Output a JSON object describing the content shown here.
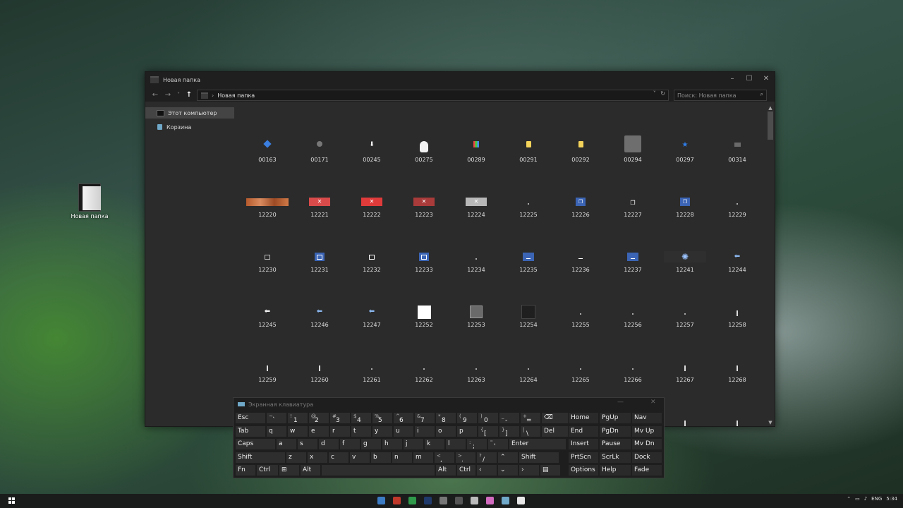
{
  "desktop": {
    "icon_label": "Новая папка"
  },
  "window": {
    "title": "Новая папка",
    "controls": {
      "minimize": "–",
      "maximize": "☐",
      "close": "✕"
    },
    "nav": {
      "back": "←",
      "forward": "→",
      "recent": "˅",
      "up": "↑"
    },
    "address": {
      "separator": "›",
      "path": "Новая папка",
      "dropdown": "˅",
      "refresh": "↻"
    },
    "search": {
      "placeholder": "Поиск: Новая папка",
      "icon": "⌕"
    },
    "sidebar": [
      {
        "label": "Этот компьютер",
        "icon": "computer-icon"
      },
      {
        "label": "Корзина",
        "icon": "recycle-bin-icon"
      }
    ],
    "items": [
      {
        "label": "00163",
        "thumb": "blue-pin"
      },
      {
        "label": "00171",
        "thumb": "gray-globe"
      },
      {
        "label": "00245",
        "thumb": "down-arrow"
      },
      {
        "label": "00275",
        "thumb": "white-head"
      },
      {
        "label": "00289",
        "thumb": "color-grid"
      },
      {
        "label": "00291",
        "thumb": "yellow-note"
      },
      {
        "label": "00292",
        "thumb": "yellow-note"
      },
      {
        "label": "00294",
        "thumb": "gray-square"
      },
      {
        "label": "00297",
        "thumb": "blue-star"
      },
      {
        "label": "00314",
        "thumb": "gray-folder"
      },
      {
        "label": "12220",
        "thumb": "rust-bar"
      },
      {
        "label": "12221",
        "thumb": "red-close"
      },
      {
        "label": "12222",
        "thumb": "red-close-bright"
      },
      {
        "label": "12223",
        "thumb": "red-close-dark"
      },
      {
        "label": "12224",
        "thumb": "gray-close"
      },
      {
        "label": "12225",
        "thumb": "tiny-dot"
      },
      {
        "label": "12226",
        "thumb": "blue-restore"
      },
      {
        "label": "12227",
        "thumb": "restore"
      },
      {
        "label": "12228",
        "thumb": "blue-restore"
      },
      {
        "label": "12229",
        "thumb": "tiny-dot"
      },
      {
        "label": "12230",
        "thumb": "maximize"
      },
      {
        "label": "12231",
        "thumb": "blue-maximize"
      },
      {
        "label": "12232",
        "thumb": "maximize-white"
      },
      {
        "label": "12233",
        "thumb": "blue-maximize"
      },
      {
        "label": "12234",
        "thumb": "tiny-dot"
      },
      {
        "label": "12235",
        "thumb": "blue-minimize"
      },
      {
        "label": "12236",
        "thumb": "minimize"
      },
      {
        "label": "12237",
        "thumb": "blue-minimize"
      },
      {
        "label": "12241",
        "thumb": "gear-burst"
      },
      {
        "label": "12244",
        "thumb": "blue-left-arrow"
      },
      {
        "label": "12245",
        "thumb": "white-left-arrow"
      },
      {
        "label": "12246",
        "thumb": "blue-left-arrow"
      },
      {
        "label": "12247",
        "thumb": "blue-left-arrow"
      },
      {
        "label": "12252",
        "thumb": "white-square"
      },
      {
        "label": "12253",
        "thumb": "mid-gray-square"
      },
      {
        "label": "12254",
        "thumb": "dark-square"
      },
      {
        "label": "12255",
        "thumb": "tiny-dot"
      },
      {
        "label": "12256",
        "thumb": "tiny-dot"
      },
      {
        "label": "12257",
        "thumb": "tiny-dot"
      },
      {
        "label": "12258",
        "thumb": "thin-bar"
      },
      {
        "label": "12259",
        "thumb": "thin-bar"
      },
      {
        "label": "12260",
        "thumb": "thin-bar"
      },
      {
        "label": "12261",
        "thumb": "tiny-dot"
      },
      {
        "label": "12262",
        "thumb": "tiny-dot"
      },
      {
        "label": "12263",
        "thumb": "tiny-dot"
      },
      {
        "label": "12264",
        "thumb": "tiny-dot"
      },
      {
        "label": "12265",
        "thumb": "tiny-dot"
      },
      {
        "label": "12266",
        "thumb": "tiny-dot"
      },
      {
        "label": "12267",
        "thumb": "thin-bar"
      },
      {
        "label": "12268",
        "thumb": "thin-bar"
      },
      {
        "label": "",
        "thumb": "none"
      },
      {
        "label": "",
        "thumb": "none"
      },
      {
        "label": "",
        "thumb": "none"
      },
      {
        "label": "",
        "thumb": "none"
      },
      {
        "label": "",
        "thumb": "none"
      },
      {
        "label": "",
        "thumb": "none"
      },
      {
        "label": "",
        "thumb": "none"
      },
      {
        "label": "",
        "thumb": "none"
      },
      {
        "label": "",
        "thumb": "thin-bar"
      },
      {
        "label": "",
        "thumb": "thin-bar"
      }
    ]
  },
  "keyboard": {
    "title": "Экранная клавиатура",
    "controls": {
      "minimize": "—",
      "close": "✕"
    },
    "rows": [
      [
        {
          "p": "Esc"
        },
        {
          "s": "~",
          "p": "`"
        },
        {
          "s": "!",
          "p": "1"
        },
        {
          "s": "@",
          "p": "2"
        },
        {
          "s": "#",
          "p": "3"
        },
        {
          "s": "$",
          "p": "4"
        },
        {
          "s": "%",
          "p": "5"
        },
        {
          "s": "^",
          "p": "6"
        },
        {
          "s": "&",
          "p": "7"
        },
        {
          "s": "*",
          "p": "8"
        },
        {
          "s": "(",
          "p": "9"
        },
        {
          "s": ")",
          "p": "0"
        },
        {
          "s": "_",
          "p": "-"
        },
        {
          "s": "+",
          "p": "="
        },
        {
          "p": "⌫"
        }
      ],
      [
        {
          "p": "Tab"
        },
        {
          "p": "q"
        },
        {
          "p": "w"
        },
        {
          "p": "e"
        },
        {
          "p": "r"
        },
        {
          "p": "t"
        },
        {
          "p": "y"
        },
        {
          "p": "u"
        },
        {
          "p": "i"
        },
        {
          "p": "o"
        },
        {
          "p": "p"
        },
        {
          "s": "{",
          "p": "["
        },
        {
          "s": "}",
          "p": "]"
        },
        {
          "s": "|",
          "p": "\\"
        },
        {
          "p": "Del"
        }
      ],
      [
        {
          "p": "Caps"
        },
        {
          "p": "a"
        },
        {
          "p": "s"
        },
        {
          "p": "d"
        },
        {
          "p": "f"
        },
        {
          "p": "g"
        },
        {
          "p": "h"
        },
        {
          "p": "j"
        },
        {
          "p": "k"
        },
        {
          "p": "l"
        },
        {
          "s": ":",
          "p": ";"
        },
        {
          "s": "\"",
          "p": "'"
        },
        {
          "p": "Enter"
        }
      ],
      [
        {
          "p": "Shift"
        },
        {
          "p": "z"
        },
        {
          "p": "x"
        },
        {
          "p": "c"
        },
        {
          "p": "v"
        },
        {
          "p": "b"
        },
        {
          "p": "n"
        },
        {
          "p": "m"
        },
        {
          "s": "<",
          "p": ","
        },
        {
          "s": ">",
          "p": "."
        },
        {
          "s": "?",
          "p": "/"
        },
        {
          "p": "⌃"
        },
        {
          "p": "Shift"
        }
      ],
      [
        {
          "p": "Fn"
        },
        {
          "p": "Ctrl"
        },
        {
          "p": "⊞"
        },
        {
          "p": "Alt"
        },
        {
          "p": ""
        },
        {
          "p": "Alt"
        },
        {
          "p": "Ctrl"
        },
        {
          "p": "‹"
        },
        {
          "p": "⌄"
        },
        {
          "p": "›"
        },
        {
          "p": "▤"
        }
      ]
    ],
    "right": [
      [
        "Home",
        "PgUp",
        "Nav"
      ],
      [
        "End",
        "PgDn",
        "Mv Up"
      ],
      [
        "Insert",
        "Pause",
        "Mv Dn"
      ],
      [
        "PrtScn",
        "ScrLk",
        "Dock"
      ],
      [
        "Options",
        "Help",
        "Fade"
      ]
    ]
  },
  "taskbar": {
    "apps": [
      {
        "name": "edge-icon",
        "color": "#3c7cc4"
      },
      {
        "name": "app-red-icon",
        "color": "#c0392b"
      },
      {
        "name": "uplay-icon",
        "color": "#2e9a4a"
      },
      {
        "name": "photoshop-icon",
        "color": "#1f3a6b"
      },
      {
        "name": "app-circle-icon",
        "color": "#777777"
      },
      {
        "name": "clapper-icon",
        "color": "#555555"
      },
      {
        "name": "alien-icon",
        "color": "#bbbbbb"
      },
      {
        "name": "app-pink-icon",
        "color": "#d36cc0"
      },
      {
        "name": "keyboard-icon",
        "color": "#6fa8c8"
      },
      {
        "name": "explorer-icon",
        "color": "#e8e8e8"
      }
    ],
    "tray": {
      "lang": "ENG",
      "time": "5:34"
    }
  }
}
